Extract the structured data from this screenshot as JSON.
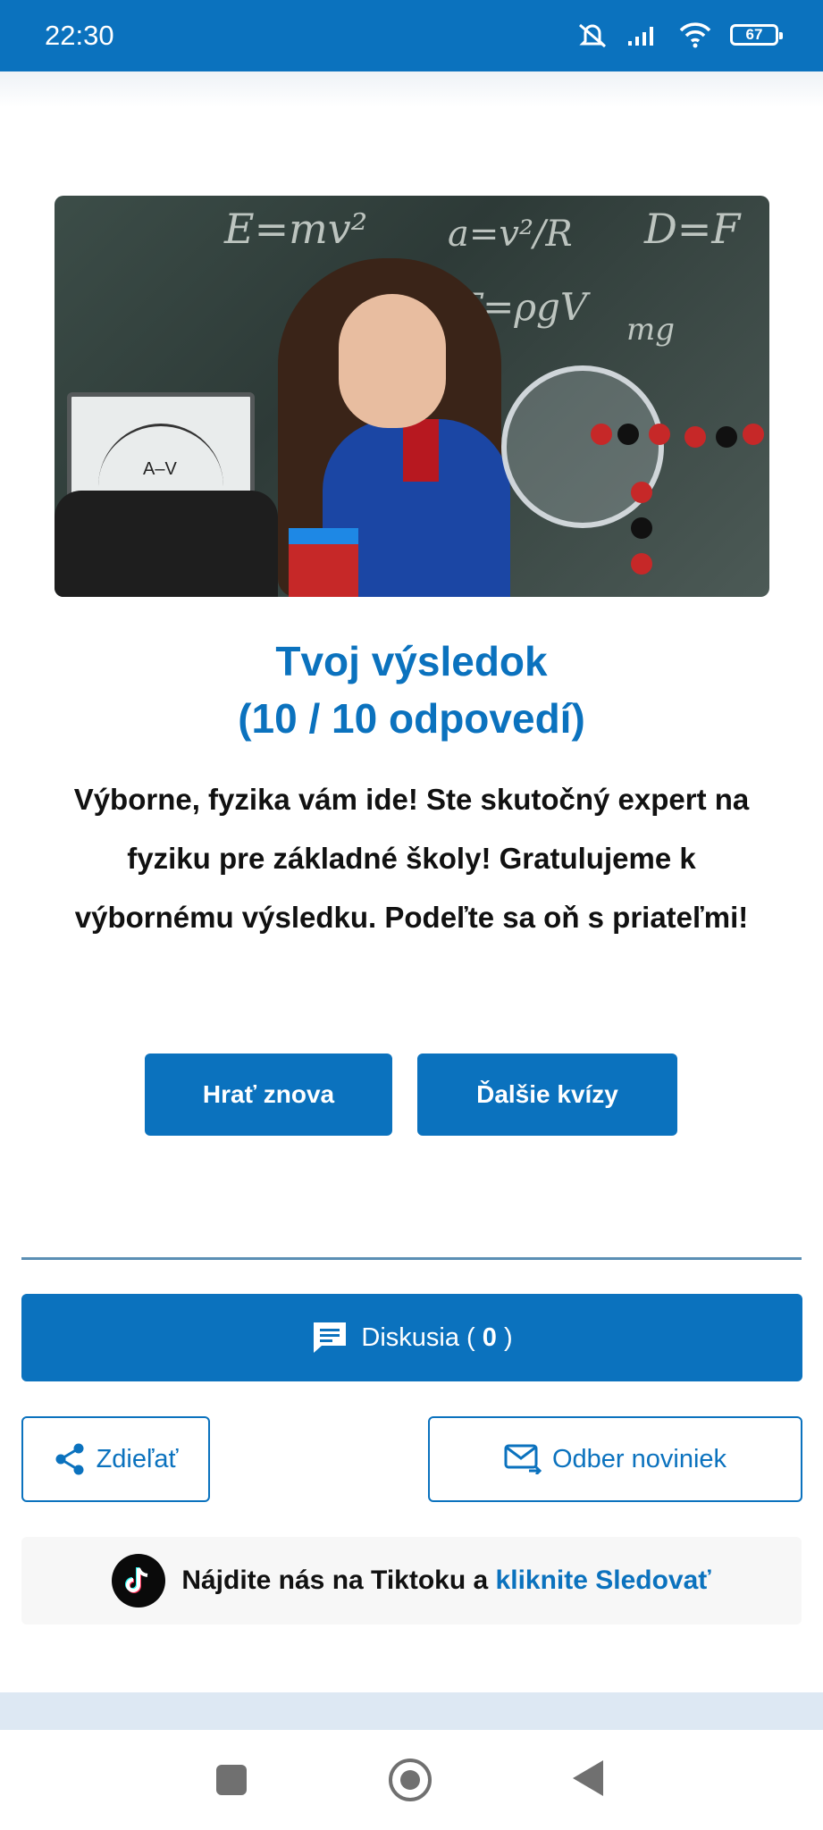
{
  "status_bar": {
    "time": "22:30",
    "battery": "67"
  },
  "result": {
    "title_line1": "Tvoj výsledok",
    "title_line2": "(10 / 10 odpovedí)",
    "message": "Výborne, fyzika vám ide! Ste skutočný expert na fyziku pre základné školy! Gratulujeme k výbornému výsledku. Podeľte sa oň s priateľmi!"
  },
  "buttons": {
    "play_again": "Hrať znova",
    "more_quizzes": "Ďalšie kvízy"
  },
  "discussion": {
    "label": "Diskusia (",
    "count": "0",
    "close": ")"
  },
  "share": {
    "label": "Zdieľať"
  },
  "newsletter": {
    "label": "Odber noviniek"
  },
  "tiktok": {
    "text": "Nájdite nás na Tiktoku a",
    "link": "kliknite Sledovať"
  },
  "colors": {
    "accent": "#0b72be",
    "text": "#111111",
    "footer_band": "#dde8f3"
  },
  "icons": {
    "status": [
      "mute-icon",
      "signal-icon",
      "wifi-icon",
      "battery-icon"
    ],
    "discussion": "chat-icon",
    "share": "share-icon",
    "newsletter": "mail-icon",
    "tiktok": "tiktok-icon",
    "nav": [
      "recents-icon",
      "home-icon",
      "back-icon"
    ]
  }
}
